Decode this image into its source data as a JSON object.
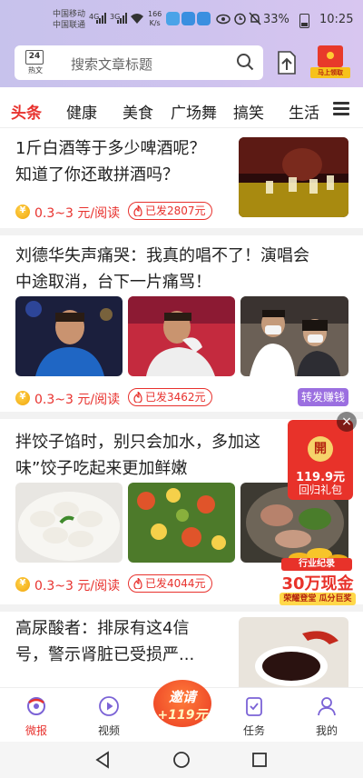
{
  "status_bar": {
    "carrier_1": "中国移动",
    "carrier_2": "中国联通",
    "net_1": "4G",
    "net_2": "3G",
    "speed_value": "166",
    "speed_unit": "K/s",
    "battery": "33%",
    "time": "10:25"
  },
  "header": {
    "hot_date": "24",
    "hot_label": "热文",
    "search_placeholder": "搜索文章标题",
    "red_packet_label": "马上领取"
  },
  "tabs": [
    {
      "label": "头条",
      "active": true
    },
    {
      "label": "健康"
    },
    {
      "label": "美食"
    },
    {
      "label": "广场舞"
    },
    {
      "label": "搞笑"
    },
    {
      "label": "生活"
    }
  ],
  "articles": [
    {
      "title_line1": "1斤白酒等于多少啤酒呢？",
      "title_line2": "知道了你还敢拼酒吗？",
      "reward": "0.3~3",
      "reward_unit": "元/阅读",
      "sent": "已发2807元"
    },
    {
      "title_line1": "刘德华失声痛哭：我真的唱不了！演唱会",
      "title_line2": "中途取消，台下一片痛骂！",
      "reward": "0.3~3",
      "reward_unit": "元/阅读",
      "sent": "已发3462元",
      "tag": "转发赚钱"
    },
    {
      "title_line1": "拌饺子馅时，别只会加水，多加这",
      "title_line2": "味”饺子吃起来更加鲜嫩",
      "reward": "0.3~3",
      "reward_unit": "元/阅读",
      "sent": "已发4044元"
    },
    {
      "title_line1": "高尿酸者：排尿有这4信",
      "title_line2": "号，警示肾脏已受损严..."
    }
  ],
  "float_ad": {
    "open": "開",
    "amount": "119.9元",
    "label": "回归礼包",
    "close": "×"
  },
  "cash_ad": {
    "line1": "行业纪录",
    "line2": "30万现金",
    "line3": "荣耀登堂 瓜分巨奖"
  },
  "bottom_nav": {
    "items": [
      {
        "label": "微报",
        "active": true
      },
      {
        "label": "视频"
      },
      {
        "label": "任务"
      },
      {
        "label": "我的"
      }
    ],
    "invite_line1": "邀请",
    "invite_line2": "+119元"
  },
  "colors": {
    "accent": "#e8312d",
    "header_gradient_start": "#c7c2ec",
    "tag_purple": "#9b6fe0"
  }
}
